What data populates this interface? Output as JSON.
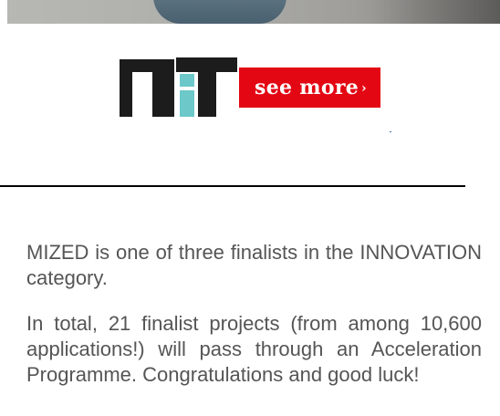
{
  "banner": {
    "logo_name": "nit-logo",
    "cta_label": "see more",
    "cta_arrow": "›",
    "cta_color": "#e30613",
    "logo_dark_color": "#1c1c1c",
    "logo_accent_color": "#6cc8c9"
  },
  "article": {
    "paragraphs": [
      "MIZED is one of three finalists in the INNOVATION category.",
      "In total, 21 finalist projects (from among 10,600 applications!) will pass through an Acceleration Programme. Congratulations and good luck!"
    ]
  }
}
